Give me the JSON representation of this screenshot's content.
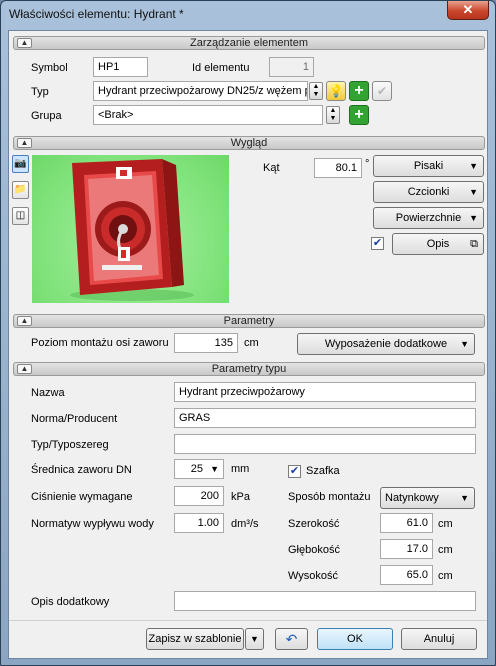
{
  "window": {
    "title": "Właściwości elementu: Hydrant *",
    "close": "✕"
  },
  "sections": {
    "management": "Zarządzanie elementem",
    "appearance": "Wygląd",
    "params": "Parametry",
    "type_params": "Parametry typu"
  },
  "management": {
    "symbol_label": "Symbol",
    "symbol_value": "HP1",
    "id_label": "Id elementu",
    "id_value": "1",
    "type_label": "Typ",
    "type_value": "Hydrant przeciwpożarowy DN25/z wężem p",
    "group_label": "Grupa",
    "group_value": "<Brak>"
  },
  "appearance": {
    "angle_label": "Kąt",
    "angle_value": "80.1",
    "angle_unit": "°",
    "pens_button": "Pisaki",
    "fonts_button": "Czcionki",
    "surfaces_button": "Powierzchnie",
    "description_button": "Opis",
    "description_checked": true
  },
  "params": {
    "mount_level_label": "Poziom montażu osi zaworu",
    "mount_level_value": "135",
    "mount_level_unit": "cm",
    "extra_equipment_button": "Wyposażenie dodatkowe"
  },
  "type_params": {
    "name_label": "Nazwa",
    "name_value": "Hydrant przeciwpożarowy",
    "norm_label": "Norma/Producent",
    "norm_value": "GRAS",
    "type_series_label": "Typ/Typoszereg",
    "type_series_value": "",
    "valve_dn_label": "Średnica zaworu DN",
    "valve_dn_value": "25",
    "valve_dn_unit": "mm",
    "pressure_label": "Ciśnienie wymagane",
    "pressure_value": "200",
    "pressure_unit": "kPa",
    "flow_label": "Normatyw wypływu wody",
    "flow_value": "1.00",
    "flow_unit": "dm³/s",
    "cabinet_label": "Szafka",
    "cabinet_checked": true,
    "mount_method_label": "Sposób montażu",
    "mount_method_value": "Natynkowy",
    "width_label": "Szerokość",
    "width_value": "61.0",
    "width_unit": "cm",
    "depth_label": "Głębokość",
    "depth_value": "17.0",
    "depth_unit": "cm",
    "height_label": "Wysokość",
    "height_value": "65.0",
    "height_unit": "cm",
    "extra_desc_label": "Opis dodatkowy",
    "extra_desc_value": ""
  },
  "footer": {
    "save_template_button": "Zapisz w szablonie",
    "ok_button": "OK",
    "cancel_button": "Anuluj"
  },
  "colors": {
    "window_frame": "#8ba6c2",
    "plus_green": "#33a333",
    "preview_green": "#7fe27a",
    "hydrant_red": "#d42a2a",
    "ok_border": "#3c7fb1"
  }
}
